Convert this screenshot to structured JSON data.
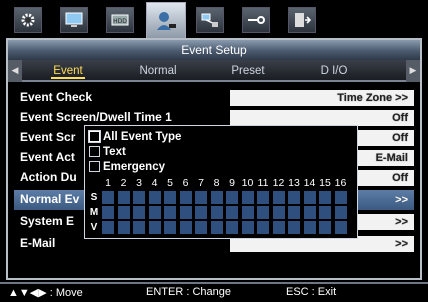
{
  "top_icons": [
    {
      "name": "gear-icon",
      "active": false
    },
    {
      "name": "monitor-icon",
      "active": false
    },
    {
      "name": "hdd-icon",
      "active": false
    },
    {
      "name": "camera-event-icon",
      "active": true
    },
    {
      "name": "network-icon",
      "active": false
    },
    {
      "name": "device-settings-icon",
      "active": false
    },
    {
      "name": "exit-icon",
      "active": false
    }
  ],
  "window": {
    "title": "Event Setup",
    "tabs": [
      "Event",
      "Normal",
      "Preset",
      "D I/O"
    ],
    "active_tab": 0
  },
  "rows": [
    {
      "label": "Event Check",
      "value": "Time Zone >>"
    },
    {
      "label": "Event Screen/Dwell Time 1",
      "value": "Off"
    },
    {
      "label": "Event Scr",
      "value": "Off"
    },
    {
      "label": "Event Act",
      "value": "E-Mail"
    },
    {
      "label": "Action Du",
      "value": "Off"
    },
    {
      "label": "Normal Ev",
      "value": ">>"
    },
    {
      "label": "System E",
      "value": ">>"
    },
    {
      "label": "E-Mail",
      "value": ">>"
    }
  ],
  "popup": {
    "options": [
      "All Event Type",
      "Text",
      "Emergency"
    ],
    "hours": [
      "1",
      "2",
      "3",
      "4",
      "5",
      "6",
      "7",
      "8",
      "9",
      "10",
      "11",
      "12",
      "13",
      "14",
      "15",
      "16"
    ],
    "grid_rows": [
      "S",
      "M",
      "V"
    ]
  },
  "status_bar": {
    "move": "▲▼◀▶ : Move",
    "change": "ENTER : Change",
    "exit": "ESC : Exit"
  },
  "colors": {
    "accent": "#ffdc5a",
    "grid_cell": "#2f4f7f",
    "highlight_row": "#4a6b94"
  }
}
